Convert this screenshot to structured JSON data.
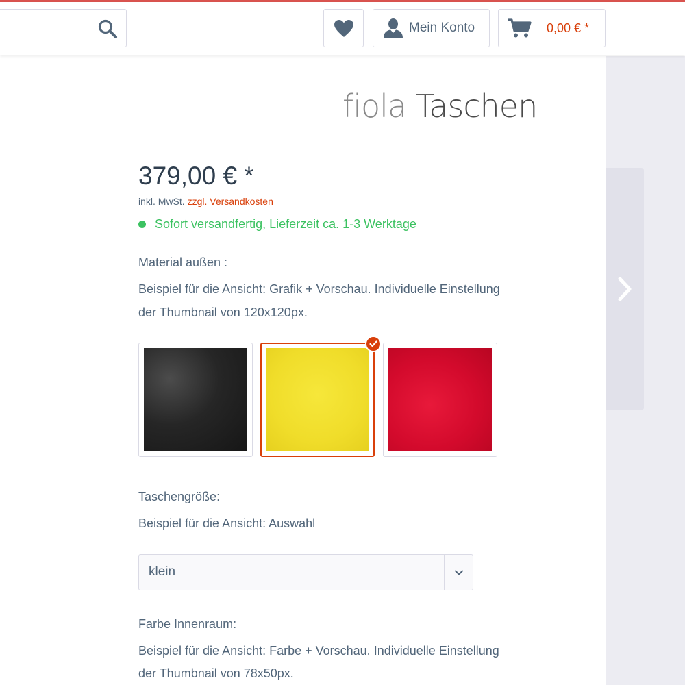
{
  "header": {
    "account_label": "Mein Konto",
    "cart_total": "0,00 € *",
    "icons": {
      "search": "search-icon",
      "wishlist": "heart-icon",
      "account": "user-icon",
      "cart": "cart-icon"
    }
  },
  "brand": {
    "part1": "fiola",
    "part2": "Taschen"
  },
  "product": {
    "price": "379,00 € *",
    "tax_prefix": "inkl. MwSt.",
    "tax_link": "zzgl. Versandkosten",
    "delivery": "Sofort versandfertig, Lieferzeit ca. 1-3 Werktage"
  },
  "material": {
    "label": "Material außen :",
    "desc_line1": "Beispiel für die Ansicht: Grafik + Vorschau. Individuelle Einstellung",
    "desc_line2": "der Thumbnail von 120x120px.",
    "swatches": [
      {
        "name": "black",
        "color": "#262626",
        "selected": false
      },
      {
        "name": "yellow",
        "color": "#f0dd2a",
        "selected": true
      },
      {
        "name": "red",
        "color": "#d30a2c",
        "selected": false
      }
    ]
  },
  "size": {
    "label": "Taschengröße:",
    "desc": "Beispiel für die Ansicht: Auswahl",
    "selected": "klein"
  },
  "interior": {
    "label": "Farbe Innenraum:",
    "desc_line1": "Beispiel für die Ansicht: Farbe + Vorschau. Individuelle Einstellung",
    "desc_line2": "der Thumbnail von 78x50px."
  },
  "colors": {
    "accent": "#d9400b",
    "success": "#3cc261",
    "text": "#52667a"
  }
}
